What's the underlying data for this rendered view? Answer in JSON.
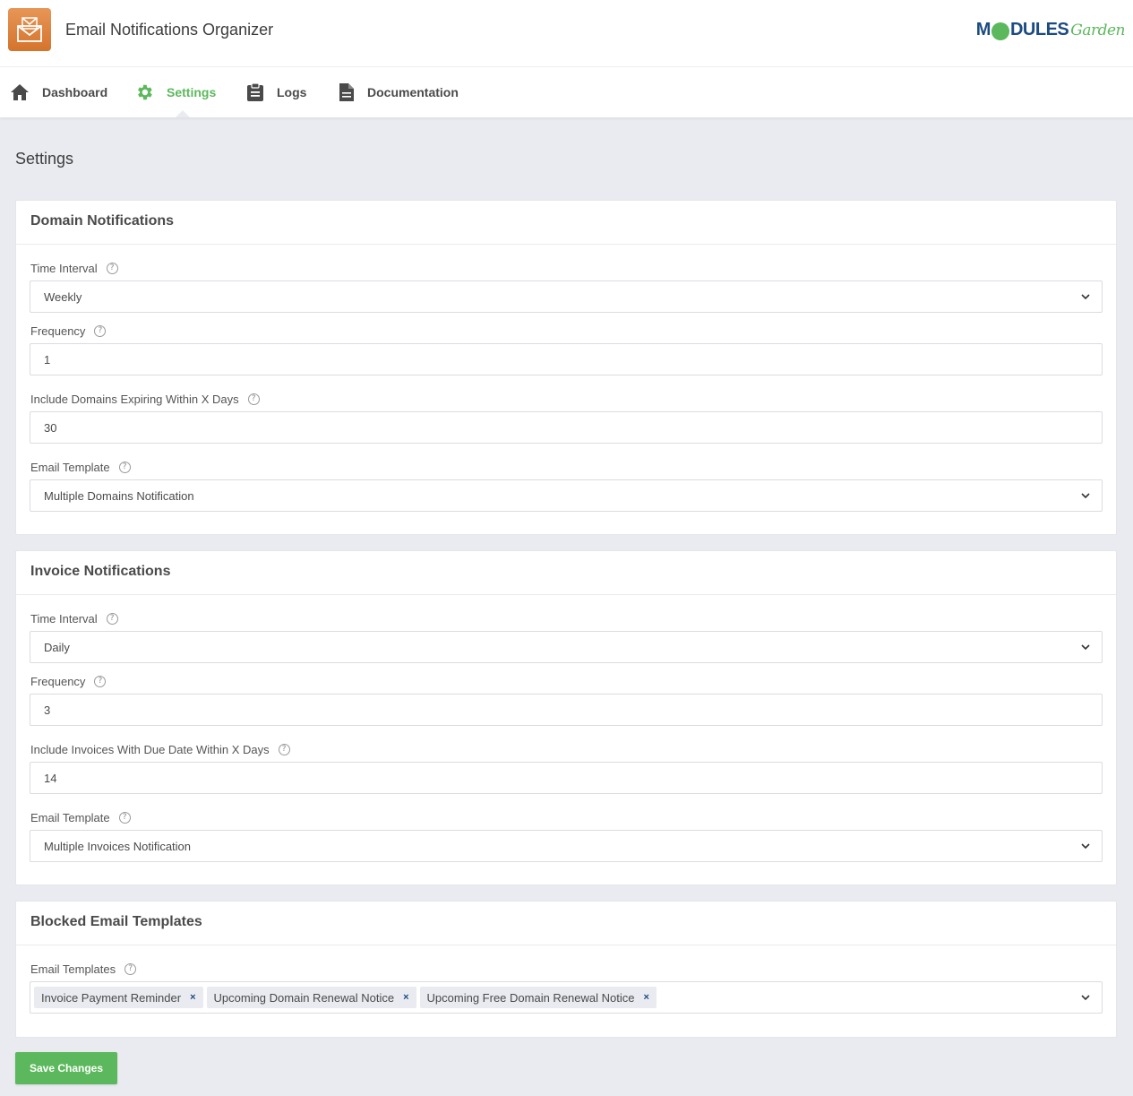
{
  "app": {
    "title": "Email Notifications Organizer",
    "icon": "envelope-icon"
  },
  "logo": {
    "brand_a": "M",
    "brand_b": "DULES",
    "brand_c": "Garden"
  },
  "nav": {
    "items": [
      {
        "label": "Dashboard",
        "icon": "home-icon"
      },
      {
        "label": "Settings",
        "icon": "gear-icon",
        "active": true
      },
      {
        "label": "Logs",
        "icon": "clipboard-icon"
      },
      {
        "label": "Documentation",
        "icon": "document-icon"
      }
    ]
  },
  "page": {
    "title": "Settings"
  },
  "domain": {
    "title": "Domain Notifications",
    "time_interval": {
      "label": "Time Interval",
      "value": "Weekly"
    },
    "frequency": {
      "label": "Frequency",
      "value": "1"
    },
    "expiring": {
      "label": "Include Domains Expiring Within X Days",
      "value": "30"
    },
    "template": {
      "label": "Email Template",
      "value": "Multiple Domains Notification"
    }
  },
  "invoice": {
    "title": "Invoice Notifications",
    "time_interval": {
      "label": "Time Interval",
      "value": "Daily"
    },
    "frequency": {
      "label": "Frequency",
      "value": "3"
    },
    "due": {
      "label": "Include Invoices With Due Date Within X Days",
      "value": "14"
    },
    "template": {
      "label": "Email Template",
      "value": "Multiple Invoices Notification"
    }
  },
  "blocked": {
    "title": "Blocked Email Templates",
    "label": "Email Templates",
    "tags": [
      "Invoice Payment Reminder",
      "Upcoming Domain Renewal Notice",
      "Upcoming Free Domain Renewal Notice"
    ],
    "remove_glyph": "×"
  },
  "help_glyph": "?",
  "save_label": "Save Changes",
  "colors": {
    "accent": "#5cb85c",
    "brand_blue": "#1c4b82",
    "icon_orange": "#e08a45"
  }
}
